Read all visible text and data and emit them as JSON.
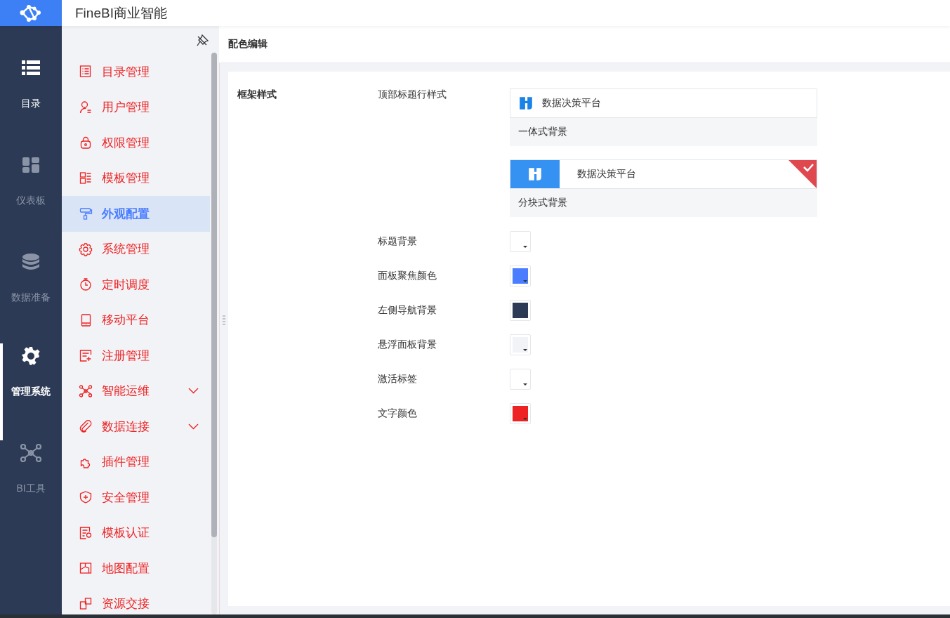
{
  "app": {
    "title": "FineBI商业智能"
  },
  "nav": [
    {
      "label": "目录",
      "selected": false,
      "hover": true
    },
    {
      "label": "仪表板",
      "selected": false,
      "hover": false
    },
    {
      "label": "数据准备",
      "selected": false,
      "hover": false
    },
    {
      "label": "管理系统",
      "selected": true,
      "hover": false
    },
    {
      "label": "BI工具",
      "selected": false,
      "hover": false
    }
  ],
  "sidebar": {
    "items": [
      {
        "label": "目录管理",
        "selected": false,
        "expandable": false
      },
      {
        "label": "用户管理",
        "selected": false,
        "expandable": false
      },
      {
        "label": "权限管理",
        "selected": false,
        "expandable": false
      },
      {
        "label": "模板管理",
        "selected": false,
        "expandable": false
      },
      {
        "label": "外观配置",
        "selected": true,
        "expandable": false
      },
      {
        "label": "系统管理",
        "selected": false,
        "expandable": false
      },
      {
        "label": "定时调度",
        "selected": false,
        "expandable": false
      },
      {
        "label": "移动平台",
        "selected": false,
        "expandable": false
      },
      {
        "label": "注册管理",
        "selected": false,
        "expandable": false
      },
      {
        "label": "智能运维",
        "selected": false,
        "expandable": true
      },
      {
        "label": "数据连接",
        "selected": false,
        "expandable": true
      },
      {
        "label": "插件管理",
        "selected": false,
        "expandable": false
      },
      {
        "label": "安全管理",
        "selected": false,
        "expandable": false
      },
      {
        "label": "模板认证",
        "selected": false,
        "expandable": false
      },
      {
        "label": "地图配置",
        "selected": false,
        "expandable": false
      },
      {
        "label": "资源交接",
        "selected": false,
        "expandable": false
      }
    ]
  },
  "page": {
    "title": "配色编辑",
    "section": "框架样式",
    "header_style": {
      "label": "顶部标题行样式",
      "options": [
        {
          "kind": "integrated",
          "preview_title": "数据决策平台",
          "caption": "一体式背景",
          "selected": false
        },
        {
          "kind": "block",
          "preview_title": "数据决策平台",
          "caption": "分块式背景",
          "selected": true
        }
      ]
    },
    "colors": [
      {
        "label": "标题背景",
        "color": "#ffffff"
      },
      {
        "label": "面板聚焦颜色",
        "color": "#4a7dff"
      },
      {
        "label": "左侧导航背景",
        "color": "#2c3a55"
      },
      {
        "label": "悬浮面板背景",
        "color": "#f2f3f7"
      },
      {
        "label": "激活标签",
        "color": "#ffffff"
      },
      {
        "label": "文字颜色",
        "color": "#ee2222"
      }
    ]
  }
}
